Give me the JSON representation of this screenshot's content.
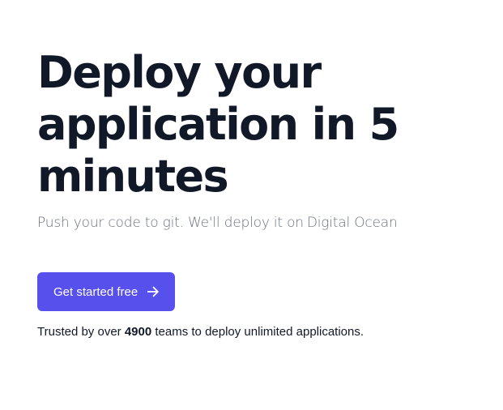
{
  "hero": {
    "title": "Deploy your application in 5 minutes",
    "subtitle_text": "Push your code to git. We'll deploy it on",
    "subtitle_brand": "Digital Ocean",
    "cta_label": "Get started free",
    "cta_icon": "arrow-right-icon",
    "trust_prefix": "Trusted by over",
    "trust_count": "4900",
    "trust_suffix": "teams to deploy unlimited applications."
  },
  "colors": {
    "title": "#111827",
    "subtitle": "#6b7280",
    "accent": "#5850ec",
    "background": "#ffffff"
  }
}
